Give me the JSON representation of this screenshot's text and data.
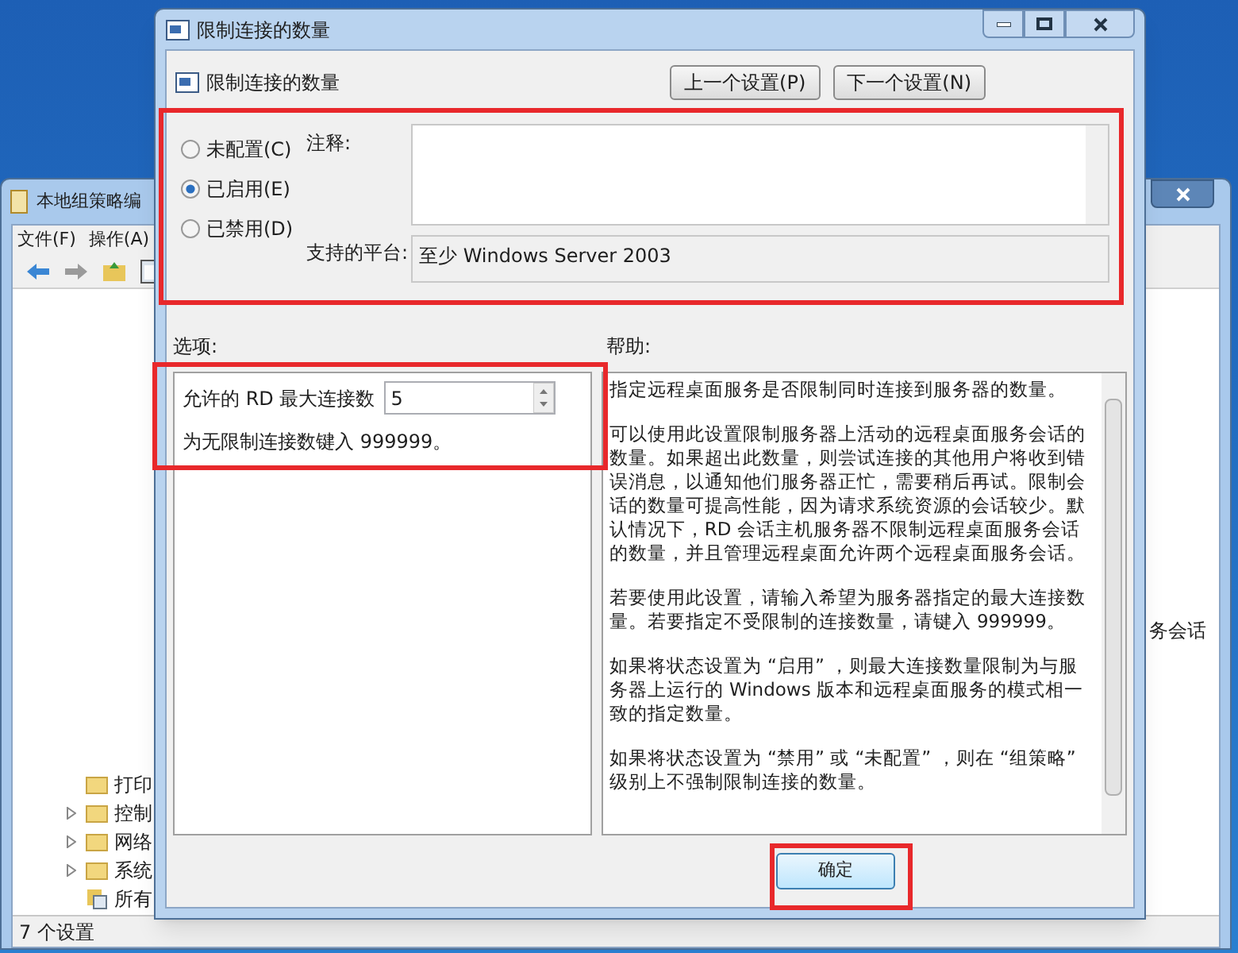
{
  "background_window": {
    "title": "本地组策略编",
    "menu": [
      "文件(F)",
      "操作(A)"
    ],
    "tree_items": [
      {
        "label": "打印",
        "kind": "leaf"
      },
      {
        "label": "控制",
        "kind": "branch"
      },
      {
        "label": "网络",
        "kind": "branch"
      },
      {
        "label": "系统",
        "kind": "branch"
      },
      {
        "label": "所有",
        "kind": "all"
      }
    ],
    "side_text": "务会话",
    "status_bar": "7 个设置"
  },
  "dialog": {
    "title": "限制连接的数量",
    "header": "限制连接的数量",
    "nav_buttons": [
      "上一个设置(P)",
      "下一个设置(N)"
    ],
    "state_options": [
      {
        "label": "未配置(C)",
        "selected": false
      },
      {
        "label": "已启用(E)",
        "selected": true
      },
      {
        "label": "已禁用(D)",
        "selected": false
      }
    ],
    "comment_label": "注释:",
    "platform_label": "支持的平台:",
    "platform_value": "至少 Windows Server 2003",
    "options_label": "选项:",
    "help_label": "帮助:",
    "options": {
      "field_label": "允许的 RD 最大连接数",
      "field_value": "5",
      "hint": "为无限制连接数键入 999999。"
    },
    "help_paragraphs": [
      "指定远程桌面服务是否限制同时连接到服务器的数量。",
      "可以使用此设置限制服务器上活动的远程桌面服务会话的数量。如果超出此数量，则尝试连接的其他用户将收到错误消息，以通知他们服务器正忙，需要稍后再试。限制会话的数量可提高性能，因为请求系统资源的会话较少。默认情况下，RD 会话主机服务器不限制远程桌面服务会话的数量，并且管理远程桌面允许两个远程桌面服务会话。",
      "若要使用此设置，请输入希望为服务器指定的最大连接数量。若要指定不受限制的连接数量，请键入 999999。",
      "如果将状态设置为 “启用” ，则最大连接数量限制为与服务器上运行的 Windows 版本和远程桌面服务的模式相一致的指定数量。",
      "如果将状态设置为 “禁用” 或 “未配置” ，则在 “组策略” 级别上不强制限制连接的数量。"
    ],
    "ok_button": "确定"
  }
}
